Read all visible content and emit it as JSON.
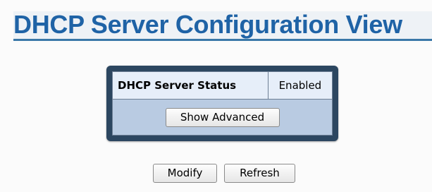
{
  "page": {
    "title": "DHCP Server Configuration View"
  },
  "status_table": {
    "rows": [
      {
        "label": "DHCP Server Status",
        "value": "Enabled"
      }
    ],
    "show_advanced_label": "Show Advanced"
  },
  "actions": {
    "modify_label": "Modify",
    "refresh_label": "Refresh"
  },
  "colors": {
    "title_text": "#1f63a6",
    "title_rule": "#3a78a8",
    "panel_border": "#2c4660",
    "cell_background": "#e6eef9",
    "panel_background": "#b9cbe2"
  }
}
